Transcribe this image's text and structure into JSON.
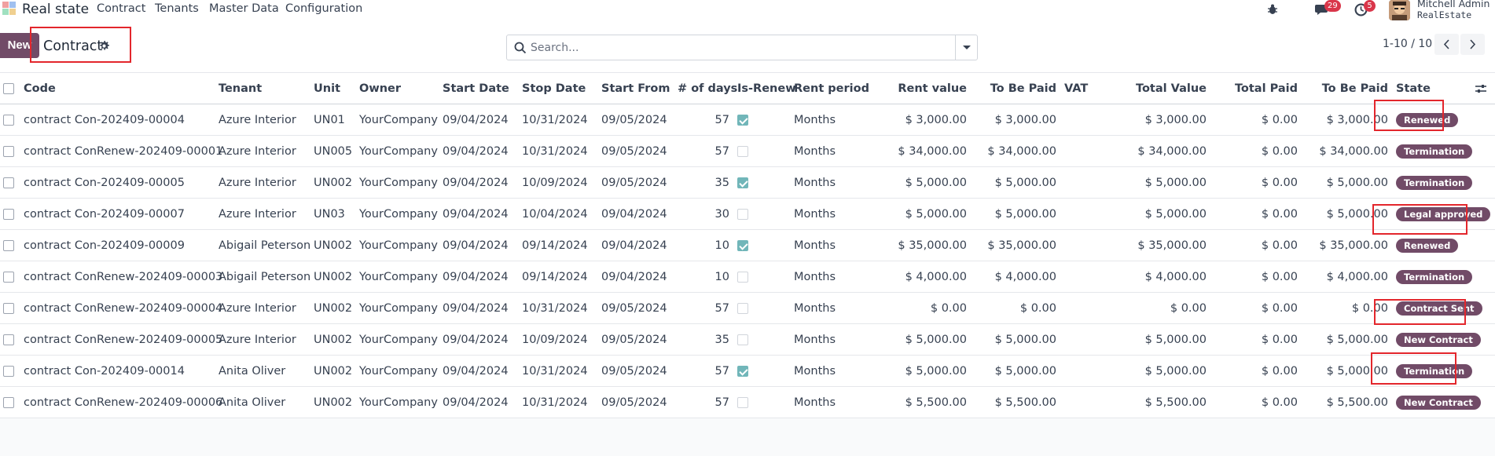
{
  "navbar": {
    "app_name": "Real state",
    "menu": [
      "Contract",
      "Tenants",
      "Master Data",
      "Configuration"
    ],
    "messages_count": "29",
    "activities_count": "5",
    "user_name": "Mitchell Admin",
    "user_company": "RealEstate"
  },
  "control": {
    "new_label": "New",
    "title": "Contract",
    "search_placeholder": "Search...",
    "pager": "1-10 / 10"
  },
  "table": {
    "headers": {
      "code": "Code",
      "tenant": "Tenant",
      "unit": "Unit",
      "owner": "Owner",
      "start_date": "Start Date",
      "stop_date": "Stop Date",
      "start_from": "Start From",
      "days": "# of days",
      "is_renew": "Is-Renew",
      "rent_period": "Rent period",
      "rent_value": "Rent value",
      "to_be_paid": "To Be Paid",
      "vat": "VAT",
      "total_value": "Total Value",
      "total_paid": "Total Paid",
      "to_be_paid2": "To Be Paid",
      "state": "State"
    },
    "rows": [
      {
        "code": "contract Con-202409-00004",
        "tenant": "Azure Interior",
        "unit": "UN01",
        "owner": "YourCompany",
        "start_date": "09/04/2024",
        "stop_date": "10/31/2024",
        "start_from": "09/05/2024",
        "days": "57",
        "is_renew": true,
        "rent_period": "Months",
        "rent_value": "$ 3,000.00",
        "to_be_paid": "$ 3,000.00",
        "total_value": "$ 3,000.00",
        "total_paid": "$ 0.00",
        "to_be_paid2": "$ 3,000.00",
        "state": "Renewed"
      },
      {
        "code": "contract ConRenew-202409-00001",
        "tenant": "Azure Interior",
        "unit": "UN005",
        "owner": "YourCompany",
        "start_date": "09/04/2024",
        "stop_date": "10/31/2024",
        "start_from": "09/05/2024",
        "days": "57",
        "is_renew": false,
        "rent_period": "Months",
        "rent_value": "$ 34,000.00",
        "to_be_paid": "$ 34,000.00",
        "total_value": "$ 34,000.00",
        "total_paid": "$ 0.00",
        "to_be_paid2": "$ 34,000.00",
        "state": "Termination"
      },
      {
        "code": "contract Con-202409-00005",
        "tenant": "Azure Interior",
        "unit": "UN002",
        "owner": "YourCompany",
        "start_date": "09/04/2024",
        "stop_date": "10/09/2024",
        "start_from": "09/05/2024",
        "days": "35",
        "is_renew": true,
        "rent_period": "Months",
        "rent_value": "$ 5,000.00",
        "to_be_paid": "$ 5,000.00",
        "total_value": "$ 5,000.00",
        "total_paid": "$ 0.00",
        "to_be_paid2": "$ 5,000.00",
        "state": "Termination"
      },
      {
        "code": "contract Con-202409-00007",
        "tenant": "Azure Interior",
        "unit": "UN03",
        "owner": "YourCompany",
        "start_date": "09/04/2024",
        "stop_date": "10/04/2024",
        "start_from": "09/04/2024",
        "days": "30",
        "is_renew": false,
        "rent_period": "Months",
        "rent_value": "$ 5,000.00",
        "to_be_paid": "$ 5,000.00",
        "total_value": "$ 5,000.00",
        "total_paid": "$ 0.00",
        "to_be_paid2": "$ 5,000.00",
        "state": "Legal approved"
      },
      {
        "code": "contract Con-202409-00009",
        "tenant": "Abigail Peterson",
        "unit": "UN002",
        "owner": "YourCompany",
        "start_date": "09/04/2024",
        "stop_date": "09/14/2024",
        "start_from": "09/04/2024",
        "days": "10",
        "is_renew": true,
        "rent_period": "Months",
        "rent_value": "$ 35,000.00",
        "to_be_paid": "$ 35,000.00",
        "total_value": "$ 35,000.00",
        "total_paid": "$ 0.00",
        "to_be_paid2": "$ 35,000.00",
        "state": "Renewed"
      },
      {
        "code": "contract ConRenew-202409-00003",
        "tenant": "Abigail Peterson",
        "unit": "UN002",
        "owner": "YourCompany",
        "start_date": "09/04/2024",
        "stop_date": "09/14/2024",
        "start_from": "09/04/2024",
        "days": "10",
        "is_renew": false,
        "rent_period": "Months",
        "rent_value": "$ 4,000.00",
        "to_be_paid": "$ 4,000.00",
        "total_value": "$ 4,000.00",
        "total_paid": "$ 0.00",
        "to_be_paid2": "$ 4,000.00",
        "state": "Termination"
      },
      {
        "code": "contract ConRenew-202409-00004",
        "tenant": "Azure Interior",
        "unit": "UN002",
        "owner": "YourCompany",
        "start_date": "09/04/2024",
        "stop_date": "10/31/2024",
        "start_from": "09/05/2024",
        "days": "57",
        "is_renew": false,
        "rent_period": "Months",
        "rent_value": "$ 0.00",
        "to_be_paid": "$ 0.00",
        "total_value": "$ 0.00",
        "total_paid": "$ 0.00",
        "to_be_paid2": "$ 0.00",
        "state": "Contract Sent"
      },
      {
        "code": "contract ConRenew-202409-00005",
        "tenant": "Azure Interior",
        "unit": "UN002",
        "owner": "YourCompany",
        "start_date": "09/04/2024",
        "stop_date": "10/09/2024",
        "start_from": "09/05/2024",
        "days": "35",
        "is_renew": false,
        "rent_period": "Months",
        "rent_value": "$ 5,000.00",
        "to_be_paid": "$ 5,000.00",
        "total_value": "$ 5,000.00",
        "total_paid": "$ 0.00",
        "to_be_paid2": "$ 5,000.00",
        "state": "New Contract"
      },
      {
        "code": "contract Con-202409-00014",
        "tenant": "Anita Oliver",
        "unit": "UN002",
        "owner": "YourCompany",
        "start_date": "09/04/2024",
        "stop_date": "10/31/2024",
        "start_from": "09/05/2024",
        "days": "57",
        "is_renew": true,
        "rent_period": "Months",
        "rent_value": "$ 5,000.00",
        "to_be_paid": "$ 5,000.00",
        "total_value": "$ 5,000.00",
        "total_paid": "$ 0.00",
        "to_be_paid2": "$ 5,000.00",
        "state": "Termination"
      },
      {
        "code": "contract ConRenew-202409-00006",
        "tenant": "Anita Oliver",
        "unit": "UN002",
        "owner": "YourCompany",
        "start_date": "09/04/2024",
        "stop_date": "10/31/2024",
        "start_from": "09/05/2024",
        "days": "57",
        "is_renew": false,
        "rent_period": "Months",
        "rent_value": "$ 5,500.00",
        "to_be_paid": "$ 5,500.00",
        "total_value": "$ 5,500.00",
        "total_paid": "$ 0.00",
        "to_be_paid2": "$ 5,500.00",
        "state": "New Contract"
      }
    ]
  },
  "colors": {
    "primary": "#714b67",
    "checkbox_on": "#71b6b9",
    "highlight_box": "#e3262c",
    "badge_red": "#d9364a"
  },
  "icons": [
    "app-logo-icon",
    "bug-icon",
    "chat-icon",
    "clock-icon",
    "gear-icon",
    "search-icon",
    "caret-down-icon",
    "chevron-left-icon",
    "chevron-right-icon",
    "column-settings-icon"
  ]
}
